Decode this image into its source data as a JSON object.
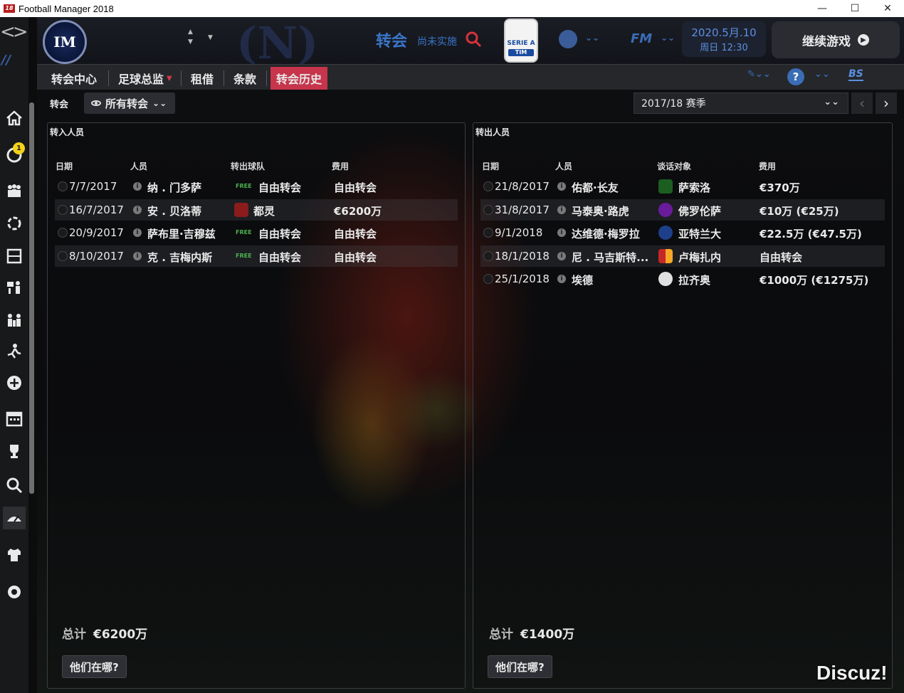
{
  "window": {
    "title": "Football Manager 2018",
    "controls": [
      "—",
      "☐",
      "✕"
    ]
  },
  "leftnav": {
    "inbox_badge": "1"
  },
  "header": {
    "section_title": "转会",
    "section_sub": "尚未实施",
    "league_badge_line1": "SERIE A",
    "league_badge_line2": "TIM",
    "fm_logo": "FM",
    "date": "2020.5月.10",
    "time": "周日 12:30",
    "continue_label": "继续游戏"
  },
  "tabs": [
    {
      "label": "转会中心"
    },
    {
      "label": "足球总监"
    },
    {
      "label": "租借"
    },
    {
      "label": "条款"
    },
    {
      "label": "转会历史"
    }
  ],
  "tools": {
    "bs": "BS",
    "help": "?"
  },
  "subbar": {
    "tab_label": "转会",
    "filter_label": "所有转会",
    "season": "2017/18 赛季"
  },
  "transfers_in": {
    "title": "转入人员",
    "headers": {
      "date": "日期",
      "person": "人员",
      "club": "转出球队",
      "fee": "费用"
    },
    "rows": [
      {
        "date": "7/7/2017",
        "person": "纳 . 门多萨",
        "club": "自由转会",
        "fee": "自由转会",
        "free": "FREE"
      },
      {
        "date": "16/7/2017",
        "person": "安 . 贝洛蒂",
        "club": "都灵",
        "fee": "€6200万",
        "free": ""
      },
      {
        "date": "20/9/2017",
        "person": "萨布里·吉穆兹",
        "club": "自由转会",
        "fee": "自由转会",
        "free": "FREE"
      },
      {
        "date": "8/10/2017",
        "person": "克 . 吉梅内斯",
        "club": "自由转会",
        "fee": "自由转会",
        "free": "FREE"
      }
    ],
    "total_label": "总计",
    "total_value": "€6200万",
    "where_button": "他们在哪?"
  },
  "transfers_out": {
    "title": "转出人员",
    "headers": {
      "date": "日期",
      "person": "人员",
      "club": "谈话对象",
      "fee": "费用"
    },
    "rows": [
      {
        "date": "21/8/2017",
        "person": "佑都·长友",
        "club": "萨索洛",
        "fee": "€370万"
      },
      {
        "date": "31/8/2017",
        "person": "马泰奥·路虎",
        "club": "佛罗伦萨",
        "fee": "€10万 (€25万)"
      },
      {
        "date": "9/1/2018",
        "person": "达维德·梅罗拉",
        "club": "亚特兰大",
        "fee": "€22.5万 (€47.5万)"
      },
      {
        "date": "18/1/2018",
        "person": "尼 . 马吉斯特...",
        "club": "卢梅扎内",
        "fee": "自由转会"
      },
      {
        "date": "25/1/2018",
        "person": "埃德",
        "club": "拉齐奥",
        "fee": "€1000万 (€1275万)"
      }
    ],
    "total_label": "总计",
    "total_value": "€1400万",
    "where_button": "他们在哪?"
  },
  "watermark": "Discuz!",
  "colors": {
    "accent_blue": "#3a6db5",
    "active_tab": "#c6354b",
    "free_green": "#4caf50"
  }
}
